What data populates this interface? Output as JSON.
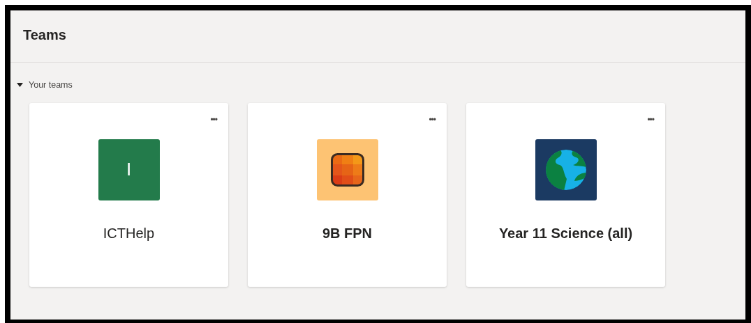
{
  "header": {
    "title": "Teams"
  },
  "section": {
    "label": "Your teams",
    "expanded": true
  },
  "teams": [
    {
      "name": "ICTHelp",
      "unread": false,
      "kind": "letter",
      "initial": "I",
      "color": "#237b4b",
      "more": "•••"
    },
    {
      "name": "9B FPN",
      "unread": true,
      "kind": "grid",
      "color": "#fdc373",
      "more": "•••"
    },
    {
      "name": "Year 11 Science (all)",
      "unread": true,
      "kind": "globe",
      "color": "#1b3a62",
      "more": "•••"
    }
  ]
}
